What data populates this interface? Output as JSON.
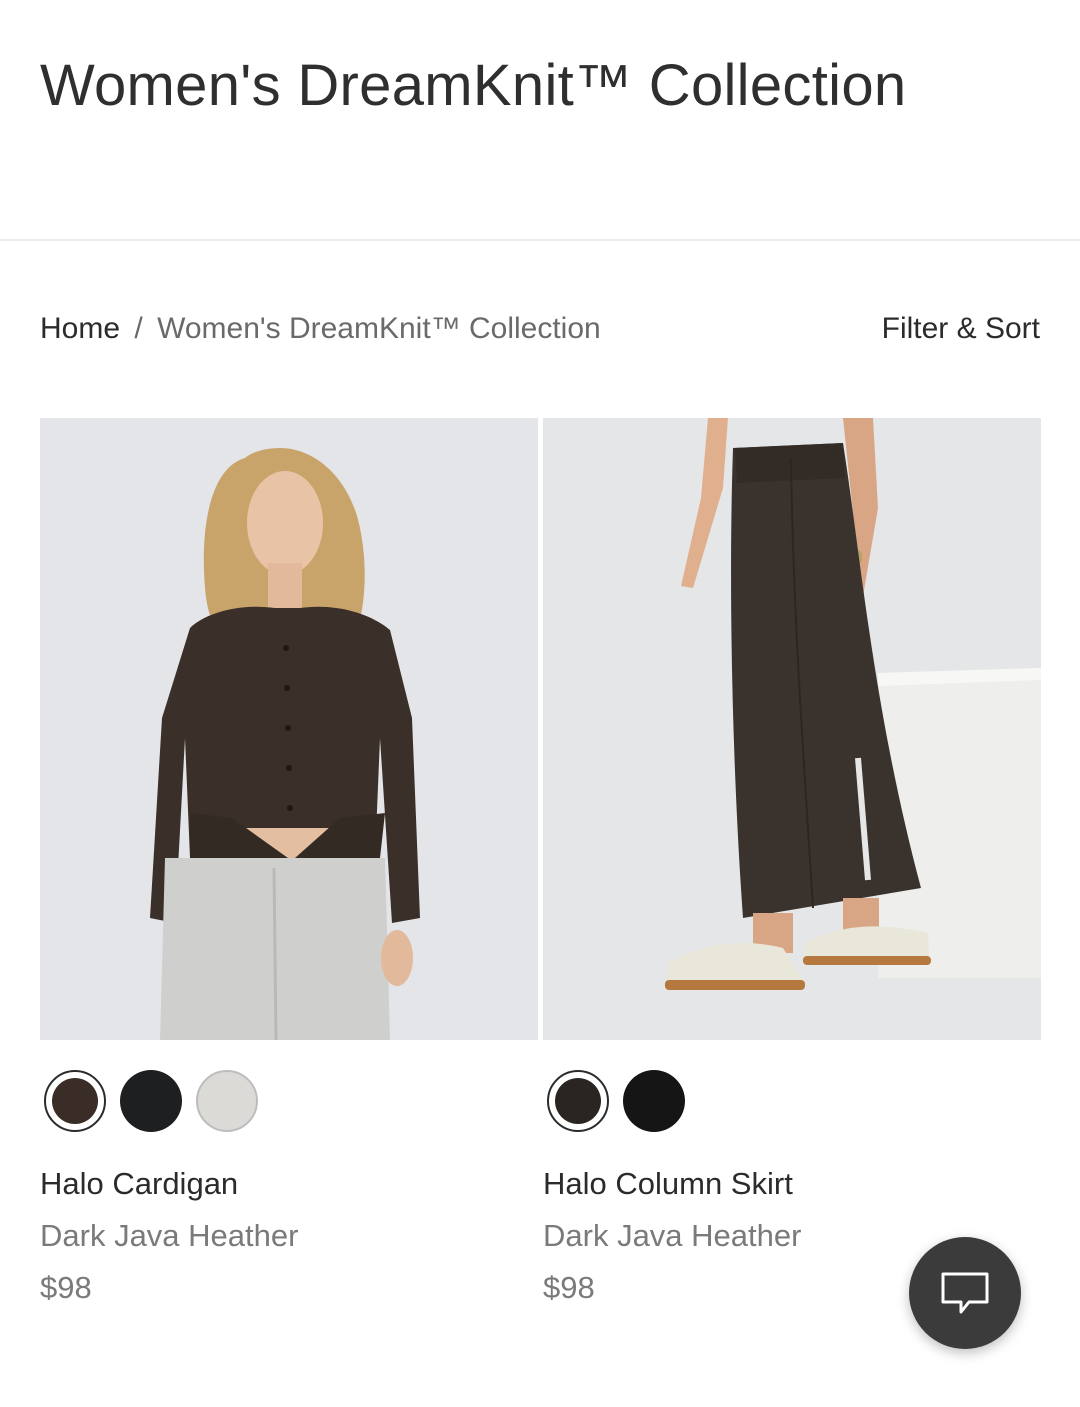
{
  "page": {
    "title": "Women's DreamKnit™ Collection"
  },
  "breadcrumb": {
    "home": "Home",
    "separator": "/",
    "current": "Women's DreamKnit™ Collection"
  },
  "toolbar": {
    "filter_sort_label": "Filter & Sort"
  },
  "products": [
    {
      "name": "Halo Cardigan",
      "color": "Dark Java Heather",
      "price": "$98",
      "swatches": [
        {
          "color": "#3a2c26",
          "selected": true
        },
        {
          "color": "#1e1f20",
          "selected": false
        },
        {
          "color": "#dcdad6",
          "selected": false
        }
      ]
    },
    {
      "name": "Halo Column Skirt",
      "color": "Dark Java Heather",
      "price": "$98",
      "swatches": [
        {
          "color": "#2a2520",
          "selected": true
        },
        {
          "color": "#151515",
          "selected": false
        }
      ]
    }
  ],
  "chat": {
    "icon": "chat-bubble-icon"
  },
  "colors": {
    "text_primary": "#2b2b2b",
    "text_secondary": "#7a7a7a",
    "chat_button": "#3b3b3b"
  }
}
